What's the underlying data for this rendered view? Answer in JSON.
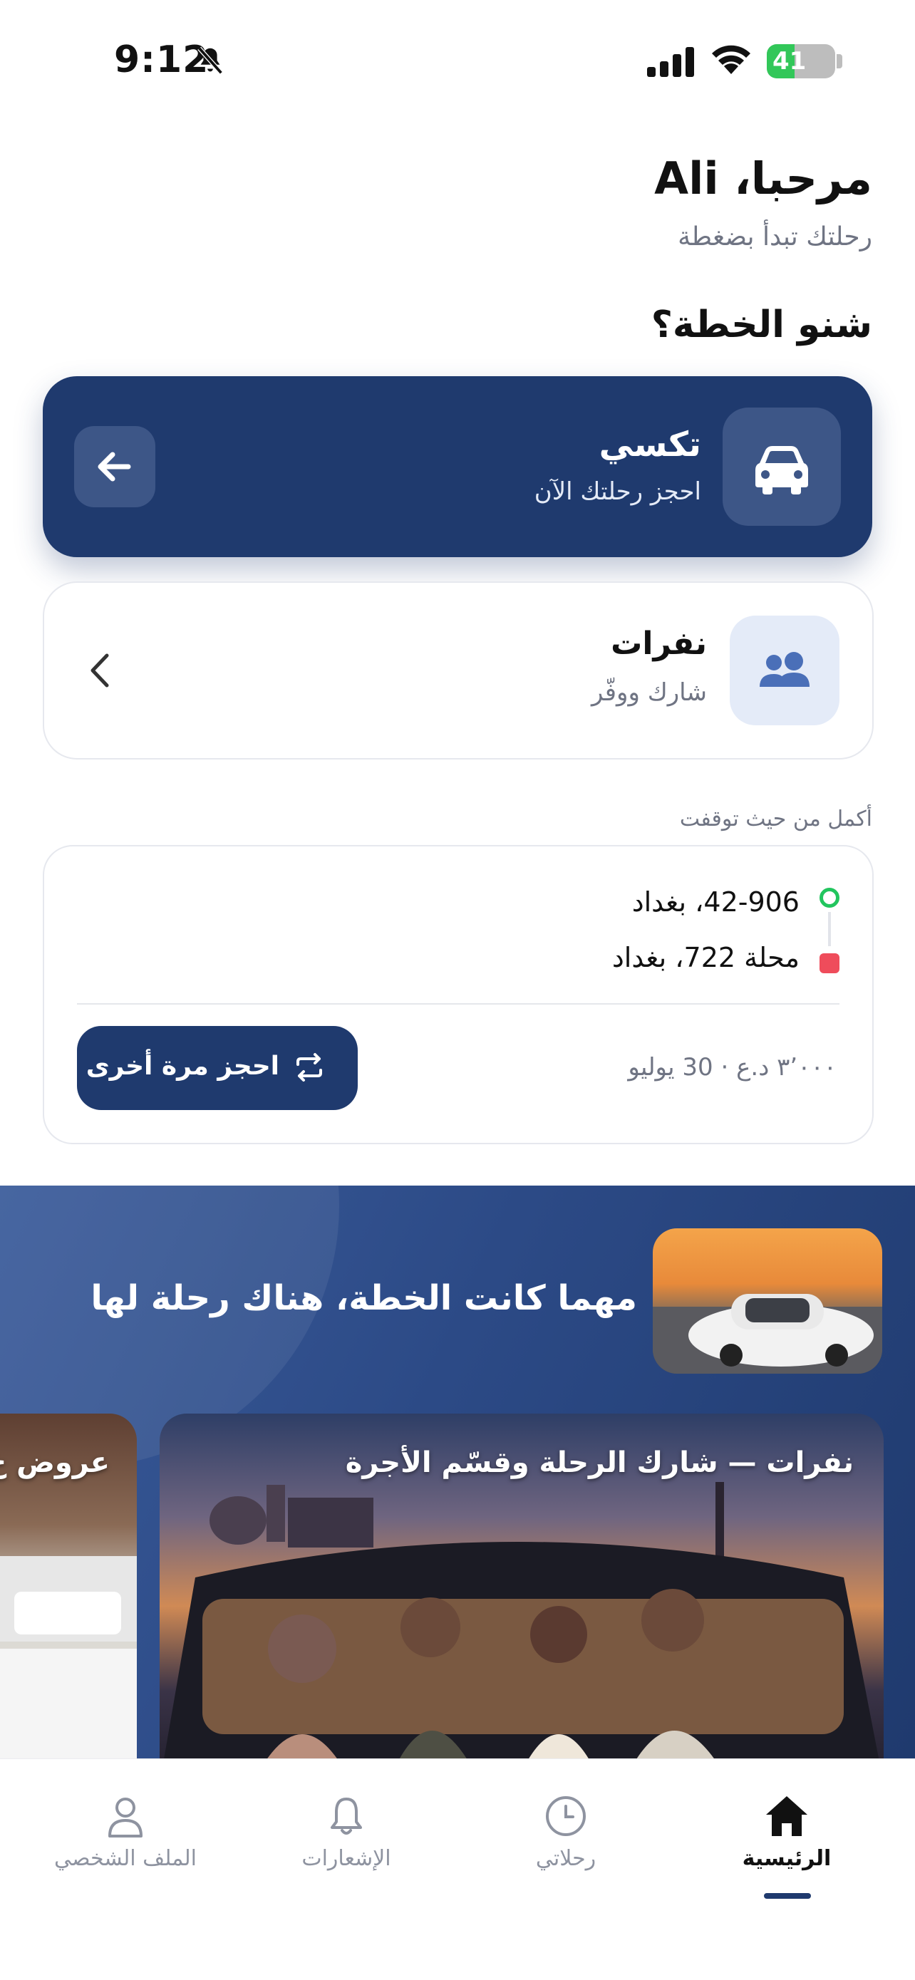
{
  "status_bar": {
    "time": "9:12",
    "battery_percent": "41",
    "battery_level": 0.41
  },
  "header": {
    "greeting": "مرحبا، Ali",
    "subtitle": "رحلتك تبدأ بضغطة"
  },
  "plan": {
    "question": "شنو الخطة؟",
    "taxi": {
      "title": "تكسي",
      "subtitle": "احجز رحلتك الآن",
      "icon": "car-icon"
    },
    "nafarat": {
      "title": "نفرات",
      "subtitle": "شارك ووفّر",
      "icon": "users-icon"
    }
  },
  "continue_section": {
    "label": "أكمل من حيث توقفت",
    "trip": {
      "origin": "42-906، بغداد",
      "destination": "محلة 722، بغداد",
      "meta": "٣٬٠٠٠ د.ع · 30 يوليو",
      "rebook_label": "احجز مرة أخرى"
    }
  },
  "promo": {
    "title": "مهما كانت الخطة، هناك رحلة لها",
    "card_main": "نفرات — شارك الرحلة وقسّم الأجرة",
    "card_side": "عروض خ"
  },
  "tabbar": {
    "items": [
      {
        "label": "الرئيسية",
        "icon": "home-icon",
        "active": true
      },
      {
        "label": "رحلاتي",
        "icon": "clock-icon",
        "active": false
      },
      {
        "label": "الإشعارات",
        "icon": "bell-icon",
        "active": false
      },
      {
        "label": "الملف الشخصي",
        "icon": "user-icon",
        "active": false
      }
    ]
  },
  "colors": {
    "primary": "#1f3a6e",
    "accent_green": "#22c55e",
    "accent_red": "#ef4c5b",
    "muted": "#6f7483"
  }
}
